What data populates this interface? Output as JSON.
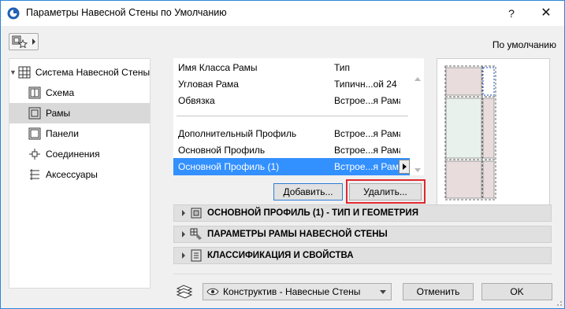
{
  "window": {
    "title": "Параметры Навесной Стены по Умолчанию",
    "help": "?",
    "close": "✕"
  },
  "toolbar": {
    "default_label": "По умолчанию"
  },
  "tree": {
    "root": {
      "label": "Система Навесной Стены",
      "icon": "grid-icon"
    },
    "items": [
      {
        "label": "Схема",
        "icon": "scheme-icon"
      },
      {
        "label": "Рамы",
        "icon": "frame-icon",
        "selected": true
      },
      {
        "label": "Панели",
        "icon": "panel-icon"
      },
      {
        "label": "Соединения",
        "icon": "junction-icon"
      },
      {
        "label": "Аксессуары",
        "icon": "accessory-icon"
      }
    ]
  },
  "params": {
    "rows": [
      {
        "name": "Имя Класса Рамы",
        "value": "Тип"
      },
      {
        "name": "Угловая Рама",
        "value": "Типичн...ой 24"
      },
      {
        "name": "Обвязка",
        "value": "Встрое...я Рама"
      },
      {
        "name": "Дополнительный Профиль",
        "value": "Встрое...я Рама"
      },
      {
        "name": "Основной Профиль",
        "value": "Встрое...я Рама"
      },
      {
        "name": "Основной Профиль (1)",
        "value": "Встрое...я Рама",
        "selected": true
      }
    ]
  },
  "buttons": {
    "add": "Добавить...",
    "delete": "Удалить...",
    "cancel": "Отменить",
    "ok": "OK"
  },
  "sections": [
    {
      "label": "ОСНОВНОЙ ПРОФИЛЬ (1) - ТИП И ГЕОМЕТРИЯ",
      "icon": "profile-icon"
    },
    {
      "label": "ПАРАМЕТРЫ РАМЫ НАВЕСНОЙ СТЕНЫ",
      "icon": "frame-params-icon"
    },
    {
      "label": "КЛАССИФИКАЦИЯ И СВОЙСТВА",
      "icon": "classification-icon"
    }
  ],
  "layer": {
    "value": "Конструктив - Навесные Стены"
  },
  "colors": {
    "selection": "#3390ff",
    "highlight": "#e0282e",
    "panel_fill": "#e9dcdc",
    "glass_fill": "#e8f1ec"
  }
}
